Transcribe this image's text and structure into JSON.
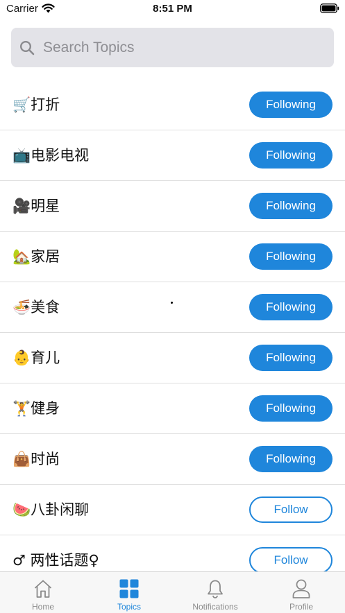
{
  "status": {
    "carrier": "Carrier",
    "time": "8:51 PM"
  },
  "search": {
    "placeholder": "Search Topics",
    "value": ""
  },
  "topics": [
    {
      "name": "🛒打折",
      "action": "Following"
    },
    {
      "name": "📺电影电视",
      "action": "Following"
    },
    {
      "name": "🎥明星",
      "action": "Following"
    },
    {
      "name": "🏡家居",
      "action": "Following"
    },
    {
      "name": "🍜美食",
      "action": "Following"
    },
    {
      "name": "👶育儿",
      "action": "Following"
    },
    {
      "name": "🏋健身",
      "action": "Following"
    },
    {
      "name": "👜时尚",
      "action": "Following"
    },
    {
      "name": "🍉八卦闲聊",
      "action": "Follow"
    },
    {
      "name": "♂ 两性话题♀",
      "action": "Follow"
    }
  ],
  "tabs": [
    {
      "label": "Home",
      "icon": "home-icon"
    },
    {
      "label": "Topics",
      "icon": "grid-icon"
    },
    {
      "label": "Notifications",
      "icon": "bell-icon"
    },
    {
      "label": "Profile",
      "icon": "person-icon"
    }
  ],
  "colors": {
    "accent": "#1f86db",
    "searchBg": "#e3e3e8",
    "inactiveTab": "#8a8a8a"
  }
}
